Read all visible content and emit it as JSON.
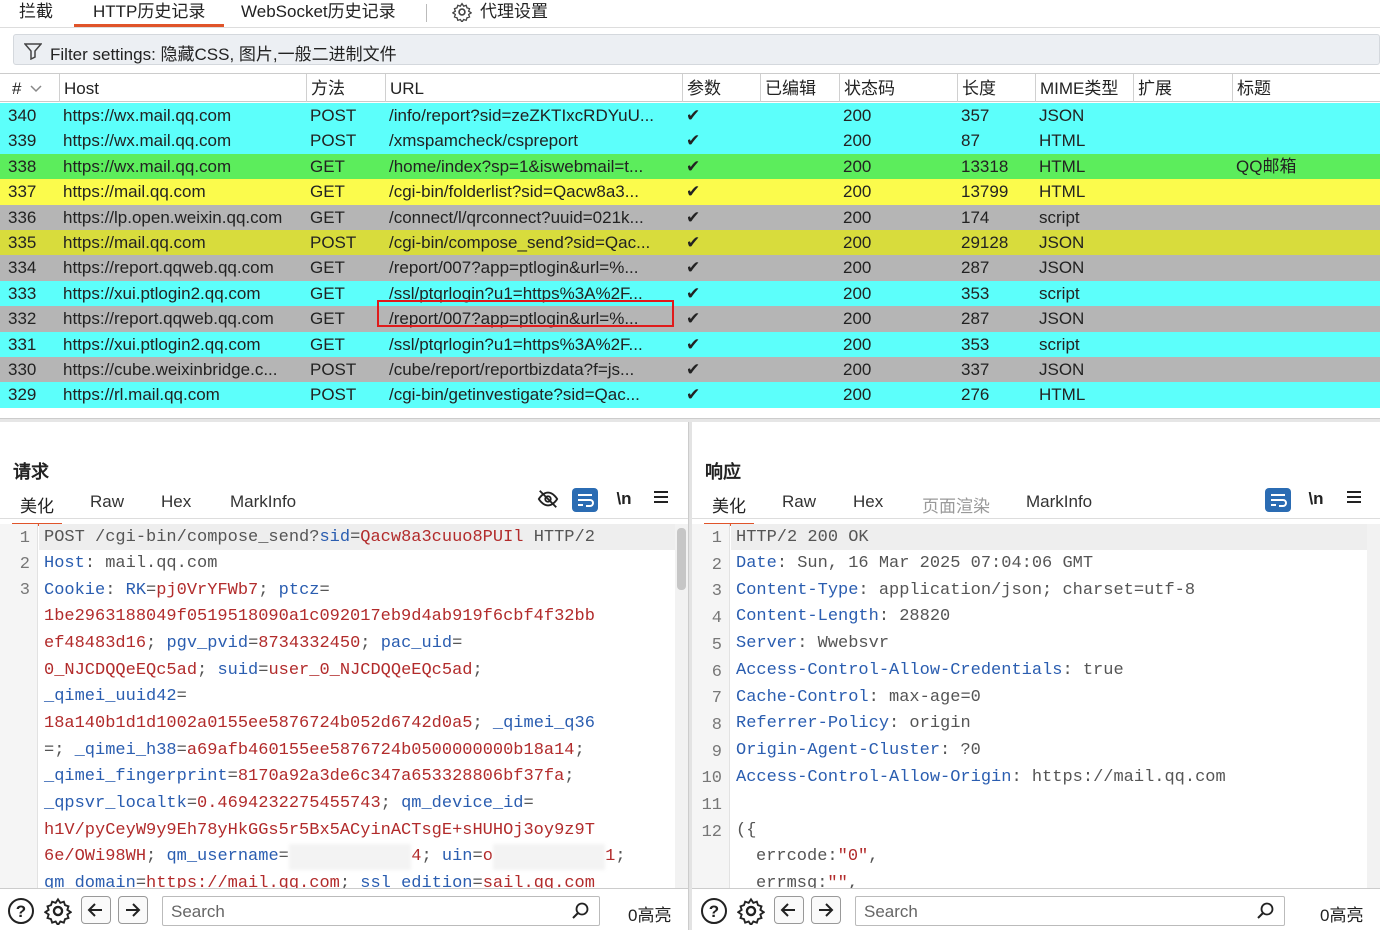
{
  "top_tabs": {
    "intercept": "拦截",
    "http_history": "HTTP历史记录",
    "websocket_history": "WebSocket历史记录",
    "proxy_settings": "代理设置"
  },
  "filter": {
    "text": "Filter settings: 隐藏CSS, 图片,一般二进制文件"
  },
  "table": {
    "headers": {
      "num": "#",
      "host": "Host",
      "method": "方法",
      "url": "URL",
      "params": "参数",
      "edited": "已编辑",
      "status": "状态码",
      "length": "长度",
      "mime": "MIME类型",
      "ext": "扩展",
      "title": "标题"
    },
    "row_colors": {
      "cyan": "#5cfffb",
      "green": "#5ced5c",
      "yellow": "#fbfb4c",
      "gray": "#b5b5b5",
      "olive": "#d8dc3c"
    },
    "rows": [
      {
        "num": "340",
        "host": "https://wx.mail.qq.com",
        "method": "POST",
        "url": "/info/report?sid=zeZKTIxcRDYuU...",
        "params": "✔",
        "status": "200",
        "length": "357",
        "mime": "JSON",
        "title": "",
        "color": "cyan"
      },
      {
        "num": "339",
        "host": "https://wx.mail.qq.com",
        "method": "POST",
        "url": "/xmspamcheck/cspreport",
        "params": "✔",
        "status": "200",
        "length": "87",
        "mime": "HTML",
        "title": "",
        "color": "cyan"
      },
      {
        "num": "338",
        "host": "https://wx.mail.qq.com",
        "method": "GET",
        "url": "/home/index?sp=1&iswebmail=t...",
        "params": "✔",
        "status": "200",
        "length": "13318",
        "mime": "HTML",
        "title": "QQ邮箱",
        "color": "green"
      },
      {
        "num": "337",
        "host": "https://mail.qq.com",
        "method": "GET",
        "url": "/cgi-bin/folderlist?sid=Qacw8a3...",
        "params": "✔",
        "status": "200",
        "length": "13799",
        "mime": "HTML",
        "title": "",
        "color": "yellow"
      },
      {
        "num": "336",
        "host": "https://lp.open.weixin.qq.com",
        "method": "GET",
        "url": "/connect/l/qrconnect?uuid=021k...",
        "params": "✔",
        "status": "200",
        "length": "174",
        "mime": "script",
        "title": "",
        "color": "gray"
      },
      {
        "num": "335",
        "host": "https://mail.qq.com",
        "method": "POST",
        "url": "/cgi-bin/compose_send?sid=Qac...",
        "params": "✔",
        "status": "200",
        "length": "29128",
        "mime": "JSON",
        "title": "",
        "color": "olive"
      },
      {
        "num": "334",
        "host": "https://report.qqweb.qq.com",
        "method": "GET",
        "url": "/report/007?app=ptlogin&url=%...",
        "params": "✔",
        "status": "200",
        "length": "287",
        "mime": "JSON",
        "title": "",
        "color": "gray"
      },
      {
        "num": "333",
        "host": "https://xui.ptlogin2.qq.com",
        "method": "GET",
        "url": "/ssl/ptqrlogin?u1=https%3A%2F...",
        "params": "✔",
        "status": "200",
        "length": "353",
        "mime": "script",
        "title": "",
        "color": "cyan"
      },
      {
        "num": "332",
        "host": "https://report.qqweb.qq.com",
        "method": "GET",
        "url": "/report/007?app=ptlogin&url=%...",
        "params": "✔",
        "status": "200",
        "length": "287",
        "mime": "JSON",
        "title": "",
        "color": "gray"
      },
      {
        "num": "331",
        "host": "https://xui.ptlogin2.qq.com",
        "method": "GET",
        "url": "/ssl/ptqrlogin?u1=https%3A%2F...",
        "params": "✔",
        "status": "200",
        "length": "353",
        "mime": "script",
        "title": "",
        "color": "cyan"
      },
      {
        "num": "330",
        "host": "https://cube.weixinbridge.c...",
        "method": "POST",
        "url": "/cube/report/reportbizdata?f=js...",
        "params": "✔",
        "status": "200",
        "length": "337",
        "mime": "JSON",
        "title": "",
        "color": "gray"
      },
      {
        "num": "329",
        "host": "https://rl.mail.qq.com",
        "method": "POST",
        "url": "/cgi-bin/getinvestigate?sid=Qac...",
        "params": "✔",
        "status": "200",
        "length": "276",
        "mime": "HTML",
        "title": "",
        "color": "cyan"
      }
    ]
  },
  "request": {
    "title": "请求",
    "tabs": {
      "pretty": "美化",
      "raw": "Raw",
      "hex": "Hex",
      "markinfo": "MarkInfo"
    },
    "newline_label": "\\n",
    "line_numbers": [
      "1",
      "2",
      "3"
    ],
    "line1": {
      "method_path": "POST /cgi-bin/compose_send?",
      "sid_key": "sid",
      "sid_val": "Qacw8a3cuuo8PUIl",
      "proto": " HTTP/2"
    },
    "line2": {
      "key": "Host",
      "val": " mail.qq.com"
    },
    "cookie_label": "Cookie",
    "cookie": {
      "rk_key": "RK",
      "rk_val": "pj0VrYFWb7",
      "ptcz_key": "ptcz",
      "ptcz_val1": "1be2963188049f0519518090a1c092017eb9d4ab919f6cbf4f32bb",
      "ptcz_val2": "ef48483d16",
      "pgv_key": "pgv_pvid",
      "pgv_val": "8734332450",
      "pac_key": "pac_uid",
      "pac_val": "0_NJCDQQeEQc5ad",
      "suid_key": "suid",
      "suid_val": "user_0_NJCDQQeEQc5ad",
      "qimei_uuid_key": "_qimei_uuid42",
      "qimei_uuid_val": "18a140b1d1d1002a0155ee5876724b052d6742d0a5",
      "qimei_q36_key": "_qimei_q36",
      "qimei_h38_key": "_qimei_h38",
      "qimei_h38_val": "a69afb460155ee5876724b0500000000b18a14",
      "qimei_fp_key": "_qimei_fingerprint",
      "qimei_fp_val": "8170a92a3de6c347a653328806bf37fa",
      "qpsvr_key": "_qpsvr_localtk",
      "qpsvr_val": "0.4694232275455743",
      "qm_dev_key": "qm_device_id",
      "qm_dev_val1": "h1V/pyCeyW9y9Eh78yHkGGs5r5Bx5ACyinACTsgE+sHUHOj3oy9z9T",
      "qm_dev_val2": "6e/OWi98WH",
      "qm_user_key": "qm_username",
      "qm_user_tail": "4",
      "uin_key": "uin",
      "uin_val_head": "o",
      "uin_tail": "1",
      "qm_domain_key": "qm_domain",
      "qm_domain_val": "https://mail.qq.com",
      "ssl_key": "ssl_edition",
      "ssl_val": "sail.qq.com"
    },
    "search_placeholder": "Search",
    "highlight": "0高亮"
  },
  "response": {
    "title": "响应",
    "tabs": {
      "pretty": "美化",
      "raw": "Raw",
      "hex": "Hex",
      "render": "页面渲染",
      "markinfo": "MarkInfo"
    },
    "newline_label": "\\n",
    "line_numbers": [
      "1",
      "2",
      "3",
      "4",
      "5",
      "6",
      "7",
      "8",
      "9",
      "10",
      "11",
      "12"
    ],
    "status_line": "HTTP/2 200 OK",
    "headers": [
      {
        "key": "Date",
        "val": " Sun, 16 Mar 2025 07:04:06 GMT"
      },
      {
        "key": "Content-Type",
        "val": " application/json; charset=utf-8"
      },
      {
        "key": "Content-Length",
        "val": " 28820"
      },
      {
        "key": "Server",
        "val": " Wwebsvr"
      },
      {
        "key": "Access-Control-Allow-Credentials",
        "val": " true"
      },
      {
        "key": "Cache-Control",
        "val": " max-age=0"
      },
      {
        "key": "Referrer-Policy",
        "val": " origin"
      },
      {
        "key": "Origin-Agent-Cluster",
        "val": " ?0"
      },
      {
        "key": "Access-Control-Allow-Origin",
        "val": " https://mail.qq.com"
      }
    ],
    "body_open": "({",
    "body_errcode_key": "errcode",
    "body_errcode_val": "\"0\"",
    "body_errmsg_key": "errmsg",
    "body_errmsg_val": "\"\"",
    "search_placeholder": "Search",
    "highlight": "0高亮"
  }
}
